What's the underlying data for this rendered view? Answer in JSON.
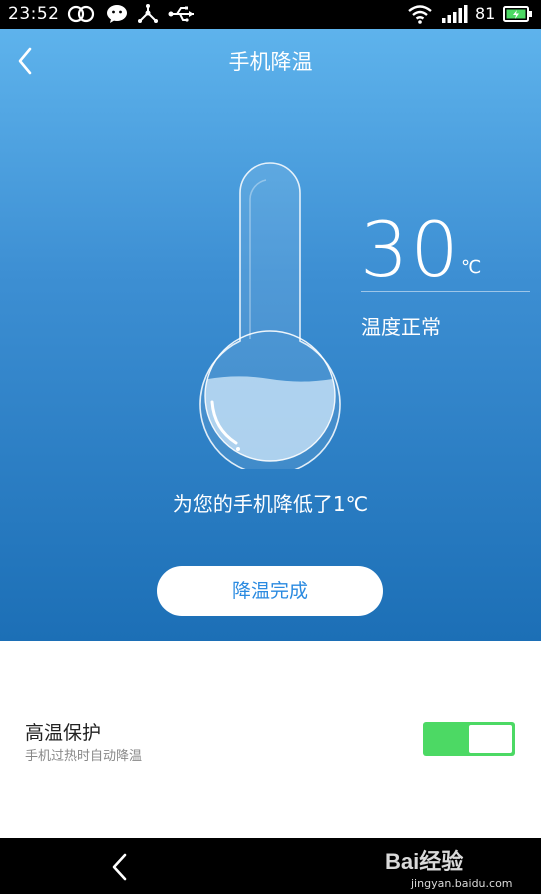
{
  "status_bar": {
    "time": "23:52",
    "battery_percent": "81",
    "icons": [
      "infinity-icon",
      "wechat-icon",
      "share-hub-icon",
      "usb-icon",
      "wifi-icon",
      "signal-icon",
      "battery-charging-icon"
    ]
  },
  "header": {
    "title": "手机降温",
    "back_icon": "back-chevron-icon"
  },
  "temperature": {
    "value": "30",
    "unit": "℃",
    "status": "温度正常"
  },
  "message": "为您的手机降低了1℃",
  "done_button": "降温完成",
  "settings": {
    "protection_title": "高温保护",
    "protection_subtitle": "手机过热时自动降温",
    "protection_enabled": true
  },
  "watermark": {
    "brand": "Bai经验",
    "url": "jingyan.baidu.com"
  },
  "colors": {
    "hero_top": "#5eb3ec",
    "hero_bottom": "#1c6fb6",
    "button_text": "#2a8ae0",
    "toggle_on": "#4cd964"
  }
}
